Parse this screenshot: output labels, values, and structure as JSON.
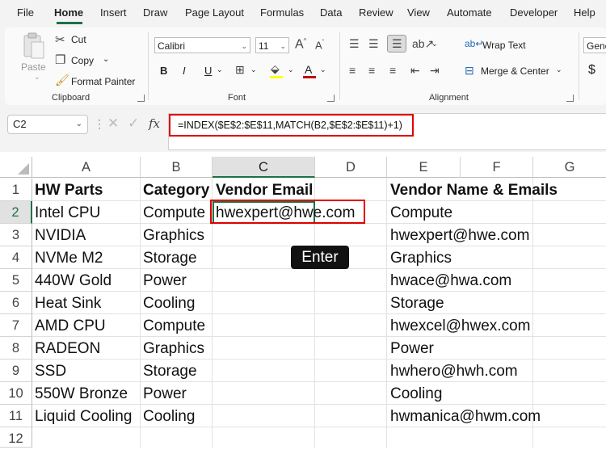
{
  "menu": {
    "tabs": [
      "File",
      "Home",
      "Insert",
      "Draw",
      "Page Layout",
      "Formulas",
      "Data",
      "Review",
      "View",
      "Automate",
      "Developer",
      "Help"
    ],
    "active": "Home"
  },
  "ribbon": {
    "clipboard": {
      "paste": "Paste",
      "cut": "Cut",
      "copy": "Copy",
      "format_painter": "Format Painter",
      "label": "Clipboard"
    },
    "font": {
      "name": "Calibri",
      "size": "11",
      "bold": "B",
      "italic": "I",
      "underline": "U",
      "font_color_glyph": "A",
      "grow_glyph": "A",
      "shrink_glyph": "A",
      "label": "Font"
    },
    "alignment": {
      "wrap_text": "Wrap Text",
      "merge_center": "Merge & Center",
      "label": "Alignment"
    },
    "number": {
      "format": "Gene",
      "currency_glyph": "$"
    },
    "colors": {
      "accent": "#1e7145",
      "highlight": "#e00000",
      "font_color_bar": "#c00000"
    }
  },
  "formula_bar": {
    "name_box": "C2",
    "fx": "fx",
    "formula": "=INDEX($E$2:$E$11,MATCH(B2,$E$2:$E$11)+1)"
  },
  "sheet": {
    "columns": [
      "A",
      "B",
      "C",
      "D",
      "E",
      "F",
      "G"
    ],
    "rows": [
      "1",
      "2",
      "3",
      "4",
      "5",
      "6",
      "7",
      "8",
      "9",
      "10",
      "11",
      "12"
    ],
    "headers": {
      "a": "HW Parts",
      "b": "Category",
      "c": "Vendor Email",
      "e": "Vendor Name & Emails"
    },
    "col_a": [
      "Intel CPU",
      "NVIDIA",
      "NVMe M2",
      "440W Gold",
      "Heat Sink",
      "AMD CPU",
      "RADEON",
      "SSD",
      "550W Bronze",
      "Liquid Cooling"
    ],
    "col_b": [
      "Compute",
      "Graphics",
      "Storage",
      "Power",
      "Cooling",
      "Compute",
      "Graphics",
      "Storage",
      "Power",
      "Cooling"
    ],
    "c2": "hwexpert@hwe.com",
    "col_e": [
      "Compute",
      "hwexpert@hwe.com",
      "Graphics",
      "hwace@hwa.com",
      "Storage",
      "hwexcel@hwex.com",
      "Power",
      "hwhero@hwh.com",
      "Cooling",
      "hwmanica@hwm.com"
    ]
  },
  "tooltip": {
    "enter": "Enter"
  }
}
